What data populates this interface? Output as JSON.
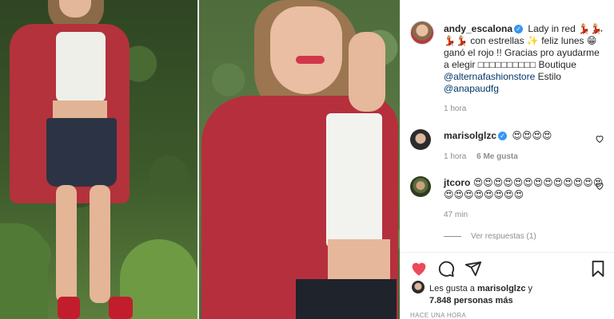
{
  "post": {
    "username": "andy_escalona",
    "caption_part1": "Lady in red 💃🏼💃🏼💃🏼💃🏼 con estrellas ✨ feliz lunes 😁 ganó el rojo !! Gracias pro ayudarme a elegir",
    "caption_boxes": "□□□□□□□□□□",
    "caption_boutique": "Boutique",
    "mention_1": "@alternafashionstore",
    "caption_estilo": "Estilo",
    "mention_2": "@anapaudfg",
    "time": "1 hora"
  },
  "comments": [
    {
      "username": "marisolglzc",
      "text": "😍😍😍😍",
      "time": "1 hora",
      "likes": "6 Me gusta"
    },
    {
      "username": "jtcoro",
      "text": "😍😍😍😍😍😍😍😍😍😍😍😍😍😍😍😍😍😍😍😍😍",
      "time": "47 min"
    }
  ],
  "replies": {
    "label": "Ver respuestas (1)"
  },
  "likes": {
    "prefix": "Les gusta a",
    "user": "marisolglzc",
    "suffix": "y",
    "count": "7.848 personas más"
  },
  "timestamp": "HACE UNA HORA",
  "colors": {
    "like_red": "#ed4956",
    "mention_blue": "#00376b",
    "verified_blue": "#3897f0",
    "meta_gray": "#8e8e8e"
  },
  "icons": {
    "like": "heart-icon",
    "comment": "comment-icon",
    "share": "share-icon",
    "save": "bookmark-icon",
    "verified": "verified-badge-icon"
  }
}
